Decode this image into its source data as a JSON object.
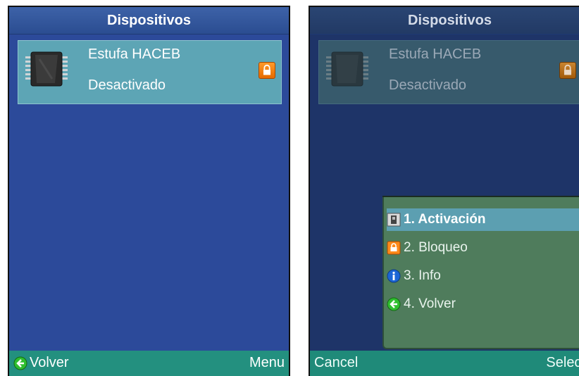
{
  "left": {
    "title": "Dispositivos",
    "device": {
      "name": "Estufa HACEB",
      "status": "Desactivado"
    },
    "softkeys": {
      "left": "Volver",
      "right": "Menu"
    }
  },
  "right": {
    "title": "Dispositivos",
    "device": {
      "name": "Estufa HACEB",
      "status": "Desactivado"
    },
    "menu": {
      "items": [
        {
          "label": "1. Activación",
          "icon": "activation-icon",
          "selected": true
        },
        {
          "label": "2. Bloqueo",
          "icon": "lock-icon",
          "selected": false
        },
        {
          "label": "3. Info",
          "icon": "info-icon",
          "selected": false
        },
        {
          "label": "4. Volver",
          "icon": "back-arrow-icon",
          "selected": false
        }
      ]
    },
    "softkeys": {
      "left": "Cancel",
      "right": "Select"
    }
  },
  "colors": {
    "background_blue": "#2c4a9a",
    "selection_teal": "#5da5b5",
    "softbar_green": "#23907f",
    "menu_green": "#4f7c5c",
    "lock_orange": "#ff8a1a"
  }
}
